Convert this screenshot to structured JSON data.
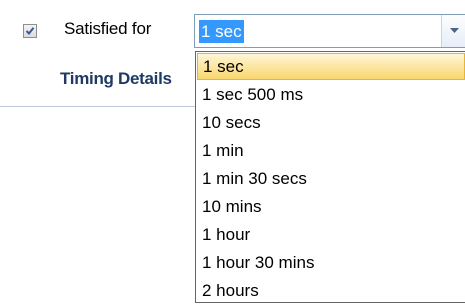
{
  "satisfied": {
    "checked": true,
    "label": "Satisfied for",
    "combo_value": "1 sec"
  },
  "timing": {
    "title": "Timing Details"
  },
  "dropdown": {
    "selected_index": 0,
    "items": [
      "1 sec",
      "1 sec 500 ms",
      "10 secs",
      "1 min",
      "1 min 30 secs",
      "10 mins",
      "1 hour",
      "1 hour 30 mins",
      "2 hours"
    ]
  }
}
